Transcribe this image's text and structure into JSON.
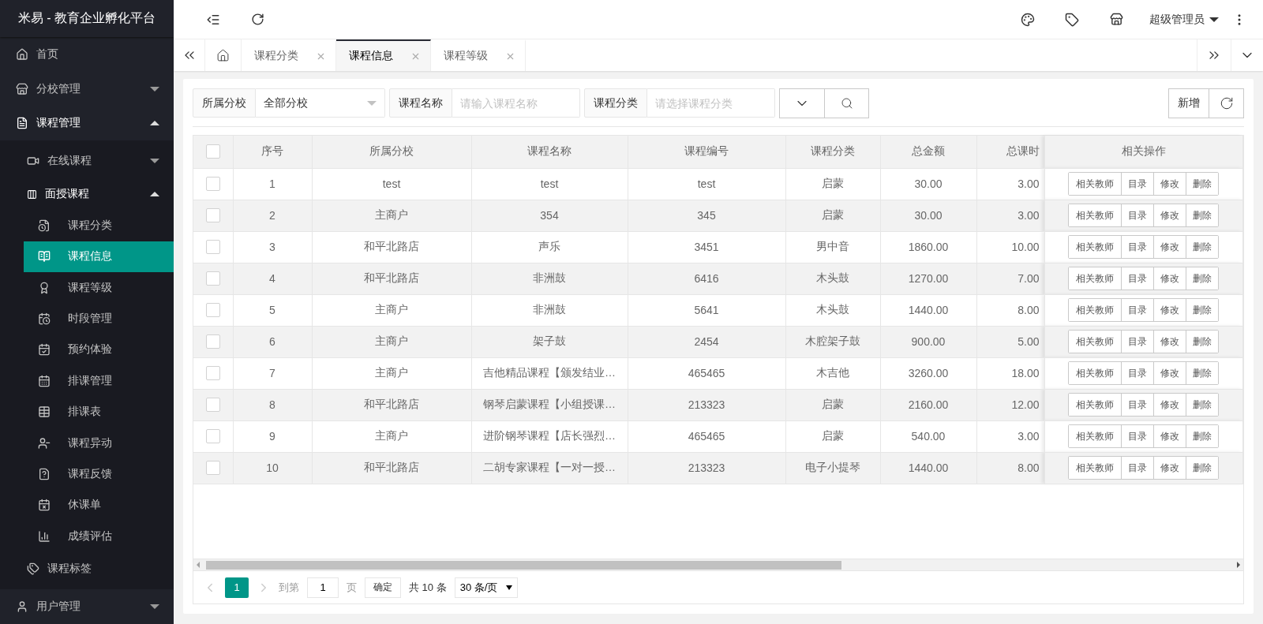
{
  "app": {
    "title": "米易 - 教育企业孵化平台"
  },
  "sidebar": {
    "items": [
      {
        "label": "首页",
        "selected": false
      },
      {
        "label": "分校管理",
        "selected": false,
        "expanded": false
      },
      {
        "label": "课程管理",
        "selected": false,
        "expanded": true,
        "children": [
          {
            "label": "在线课程",
            "selected": false,
            "expanded": false
          },
          {
            "label": "面授课程",
            "selected": false,
            "expanded": true,
            "children": [
              {
                "label": "课程分类",
                "selected": false
              },
              {
                "label": "课程信息",
                "selected": true
              },
              {
                "label": "课程等级",
                "selected": false
              },
              {
                "label": "时段管理",
                "selected": false
              },
              {
                "label": "预约体验",
                "selected": false
              },
              {
                "label": "排课管理",
                "selected": false
              },
              {
                "label": "排课表",
                "selected": false
              },
              {
                "label": "课程异动",
                "selected": false
              },
              {
                "label": "课程反馈",
                "selected": false
              },
              {
                "label": "休课单",
                "selected": false
              },
              {
                "label": "成绩评估",
                "selected": false
              }
            ]
          },
          {
            "label": "课程标签",
            "selected": false
          }
        ]
      },
      {
        "label": "用户管理",
        "selected": false,
        "expanded": false
      }
    ]
  },
  "header": {
    "user": "超级管理员"
  },
  "tabs": [
    {
      "label": "课程分类",
      "selected": false
    },
    {
      "label": "课程信息",
      "selected": true
    },
    {
      "label": "课程等级",
      "selected": false
    }
  ],
  "filters": [
    {
      "kind": "select",
      "label": "所属分校",
      "value": "全部分校"
    },
    {
      "kind": "input",
      "label": "课程名称",
      "placeholder": "请输入课程名称"
    },
    {
      "kind": "input",
      "label": "课程分类",
      "placeholder": "请选择课程分类"
    }
  ],
  "toolbar": {
    "add": "新增"
  },
  "table": {
    "select_all_checked": false,
    "columns": [
      "序号",
      "所属分校",
      "课程名称",
      "课程编号",
      "课程分类",
      "总金额",
      "总课时",
      "相关操作"
    ],
    "rows": [
      {
        "checked": false,
        "cells": [
          "1",
          "test",
          "test",
          "test",
          "启蒙",
          "30.00",
          "3.00"
        ],
        "actions": [
          "相关教师",
          "目录",
          "修改",
          "删除"
        ]
      },
      {
        "checked": false,
        "cells": [
          "2",
          "主商户",
          "354",
          "345",
          "启蒙",
          "30.00",
          "3.00"
        ],
        "actions": [
          "相关教师",
          "目录",
          "修改",
          "删除"
        ]
      },
      {
        "checked": false,
        "cells": [
          "3",
          "和平北路店",
          "声乐",
          "3451",
          "男中音",
          "1860.00",
          "10.00"
        ],
        "actions": [
          "相关教师",
          "目录",
          "修改",
          "删除"
        ]
      },
      {
        "checked": false,
        "cells": [
          "4",
          "和平北路店",
          "非洲鼓",
          "6416",
          "木头鼓",
          "1270.00",
          "7.00"
        ],
        "actions": [
          "相关教师",
          "目录",
          "修改",
          "删除"
        ]
      },
      {
        "checked": false,
        "cells": [
          "5",
          "主商户",
          "非洲鼓",
          "5641",
          "木头鼓",
          "1440.00",
          "8.00"
        ],
        "actions": [
          "相关教师",
          "目录",
          "修改",
          "删除"
        ]
      },
      {
        "checked": false,
        "cells": [
          "6",
          "主商户",
          "架子鼓",
          "2454",
          "木腔架子鼓",
          "900.00",
          "5.00"
        ],
        "actions": [
          "相关教师",
          "目录",
          "修改",
          "删除"
        ]
      },
      {
        "checked": false,
        "cells": [
          "7",
          "主商户",
          "吉他精品课程【颁发结业…",
          "465465",
          "木吉他",
          "3260.00",
          "18.00"
        ],
        "actions": [
          "相关教师",
          "目录",
          "修改",
          "删除"
        ]
      },
      {
        "checked": false,
        "cells": [
          "8",
          "和平北路店",
          "钢琴启蒙课程【小组授课…",
          "213323",
          "启蒙",
          "2160.00",
          "12.00"
        ],
        "actions": [
          "相关教师",
          "目录",
          "修改",
          "删除"
        ]
      },
      {
        "checked": false,
        "cells": [
          "9",
          "主商户",
          "进阶钢琴课程【店长强烈…",
          "465465",
          "启蒙",
          "540.00",
          "3.00"
        ],
        "actions": [
          "相关教师",
          "目录",
          "修改",
          "删除"
        ]
      },
      {
        "checked": false,
        "cells": [
          "10",
          "和平北路店",
          "二胡专家课程【一对一授…",
          "213323",
          "电子小提琴",
          "1440.00",
          "8.00"
        ],
        "actions": [
          "相关教师",
          "目录",
          "修改",
          "删除"
        ]
      }
    ]
  },
  "pagination": {
    "pages": [
      {
        "label": "1",
        "selected": true
      }
    ],
    "goto_label": "到第",
    "goto_value": "1",
    "page_label": "页",
    "confirm": "确定",
    "total": "共 10 条",
    "page_size": "30 条/页"
  }
}
